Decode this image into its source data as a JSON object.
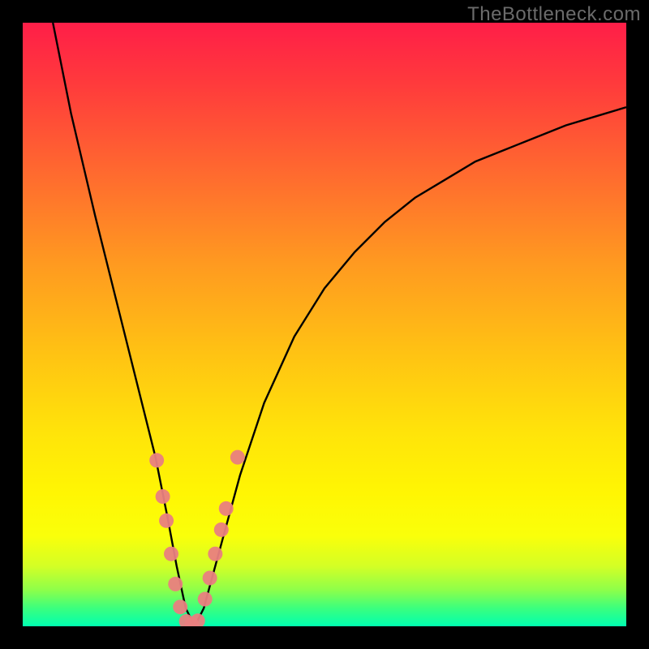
{
  "watermark": "TheBottleneck.com",
  "colors": {
    "frame": "#000000",
    "curve": "#000000",
    "marker_fill": "#e98080",
    "marker_stroke": "#c45a5a"
  },
  "chart_data": {
    "type": "line",
    "title": "",
    "xlabel": "",
    "ylabel": "",
    "xlim": [
      0,
      100
    ],
    "ylim": [
      0,
      100
    ],
    "grid": false,
    "legend": false,
    "annotations": [
      "TheBottleneck.com"
    ],
    "series": [
      {
        "name": "curve",
        "x": [
          5,
          8,
          12,
          16,
          19,
          22,
          24,
          25.5,
          27,
          28.5,
          30,
          33,
          36,
          40,
          45,
          50,
          55,
          60,
          65,
          70,
          75,
          80,
          85,
          90,
          95,
          100
        ],
        "y": [
          100,
          85,
          68,
          52,
          40,
          28,
          18,
          10,
          3,
          0,
          3,
          14,
          25,
          37,
          48,
          56,
          62,
          67,
          71,
          74,
          77,
          79,
          81,
          83,
          84.5,
          86
        ]
      }
    ],
    "markers": {
      "name": "highlighted-points",
      "x": [
        22.2,
        23.2,
        23.8,
        24.6,
        25.3,
        26.1,
        27.1,
        28.0,
        29.0,
        30.2,
        31.0,
        31.9,
        32.9,
        33.7,
        35.6
      ],
      "y": [
        27.5,
        21.5,
        17.5,
        12.0,
        7.0,
        3.2,
        0.8,
        0.3,
        0.9,
        4.5,
        8.0,
        12.0,
        16.0,
        19.5,
        28.0
      ]
    }
  }
}
